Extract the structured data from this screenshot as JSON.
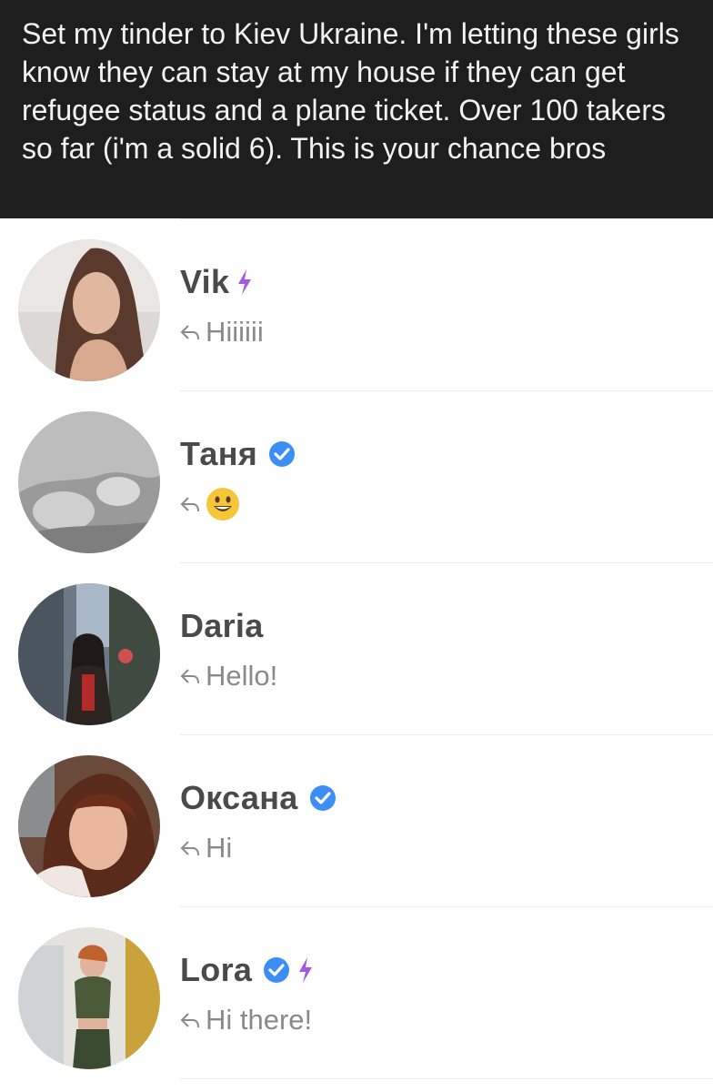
{
  "caption": {
    "text": "Set my tinder to Kiev Ukraine. I'm letting these girls know they can stay at my house if they can get refugee status and a plane ticket. Over 100 takers so far (i'm a solid 6). This is your chance bros"
  },
  "colors": {
    "caption_bg": "#1e1e1e",
    "name_text": "#4a4a4a",
    "message_text": "#8a8a8a",
    "verified_blue": "#3a8ef6",
    "boost_purple": "#a25ae0"
  },
  "icons": {
    "reply": "reply-arrow-icon",
    "verified": "verified-badge-icon",
    "boost": "lightning-bolt-icon",
    "emoji": "grinning-face-emoji"
  },
  "matches": [
    {
      "name": "Vik",
      "message": "Hiiiiii"
    },
    {
      "name": "Таня",
      "message": ""
    },
    {
      "name": "Daria",
      "message": "Hello!"
    },
    {
      "name": "Оксана",
      "message": "Hi"
    },
    {
      "name": "Lora",
      "message": "Hi there!"
    }
  ]
}
